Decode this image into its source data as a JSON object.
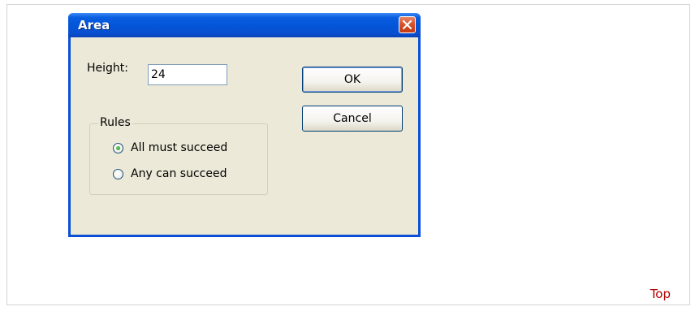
{
  "dialog": {
    "title": "Area",
    "height_label": "Height:",
    "height_value": "24",
    "ok_label": "OK",
    "cancel_label": "Cancel",
    "rules": {
      "legend": "Rules",
      "options": [
        {
          "label": "All must succeed",
          "selected": true
        },
        {
          "label": "Any can succeed",
          "selected": false
        }
      ]
    }
  },
  "footer": {
    "top_link": "Top"
  },
  "colors": {
    "titlebar": "#0a4fd6",
    "dialog_bg": "#ece9d8",
    "close_button": "#d8522a",
    "link": "#b30000"
  },
  "icons": {
    "close": "close-icon"
  }
}
